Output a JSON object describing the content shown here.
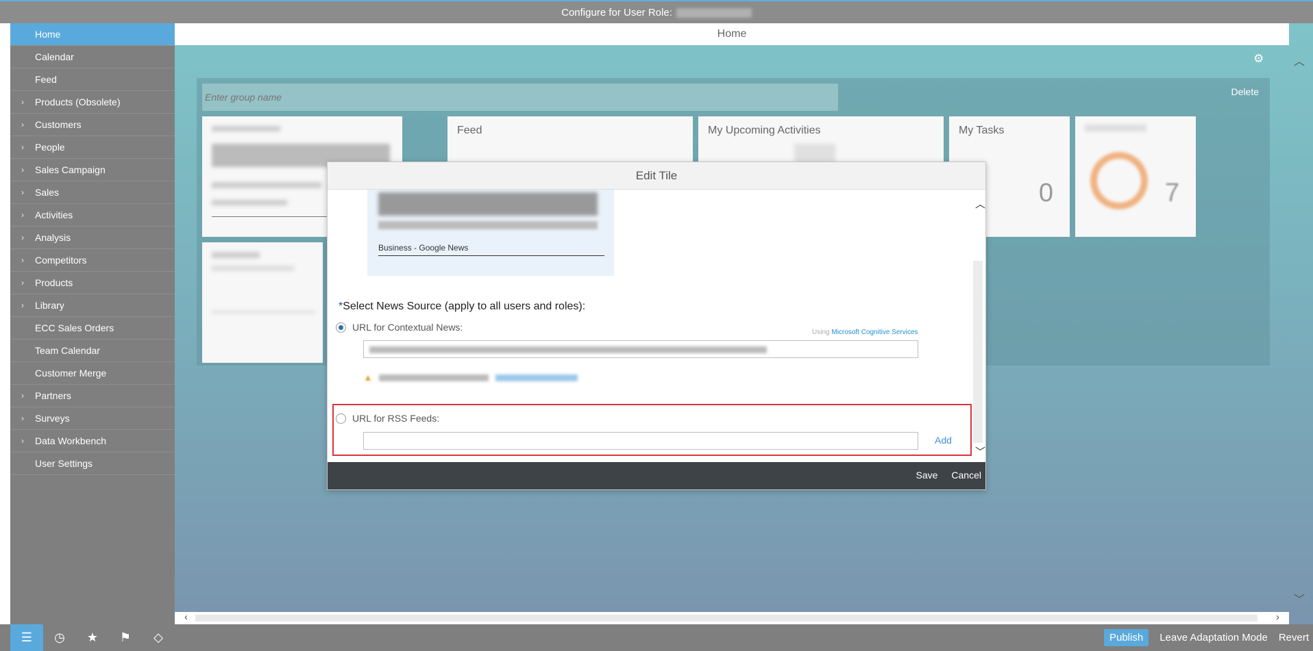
{
  "topbar": {
    "title": "Configure for User Role:"
  },
  "sidebar": {
    "items": [
      {
        "label": "Home",
        "expandable": false,
        "active": true
      },
      {
        "label": "Calendar",
        "expandable": false
      },
      {
        "label": "Feed",
        "expandable": false
      },
      {
        "label": "Products (Obsolete)",
        "expandable": true
      },
      {
        "label": "Customers",
        "expandable": true
      },
      {
        "label": "People",
        "expandable": true
      },
      {
        "label": "Sales Campaign",
        "expandable": true
      },
      {
        "label": "Sales",
        "expandable": true
      },
      {
        "label": "Activities",
        "expandable": true
      },
      {
        "label": "Analysis",
        "expandable": true
      },
      {
        "label": "Competitors",
        "expandable": true
      },
      {
        "label": "Products",
        "expandable": true
      },
      {
        "label": "Library",
        "expandable": true
      },
      {
        "label": "ECC Sales Orders",
        "expandable": false
      },
      {
        "label": "Team Calendar",
        "expandable": false
      },
      {
        "label": "Customer Merge",
        "expandable": false
      },
      {
        "label": "Partners",
        "expandable": true
      },
      {
        "label": "Surveys",
        "expandable": true
      },
      {
        "label": "Data Workbench",
        "expandable": true
      },
      {
        "label": "User Settings",
        "expandable": false
      }
    ]
  },
  "main": {
    "header": "Home",
    "group_placeholder": "Enter group name",
    "delete_label": "Delete",
    "tiles": {
      "feed": "Feed",
      "activities": "My Upcoming Activities",
      "tasks": "My Tasks",
      "tasks_count": "0",
      "closing_value": "7"
    }
  },
  "dialog": {
    "title": "Edit Tile",
    "preview_source": "Business - Google News",
    "section_title": "Select News Source (apply to all users and roles):",
    "required_mark": "*",
    "option_contextual": "URL for Contextual News:",
    "using_prefix": "Using",
    "using_link": "Microsoft Cognitive Services",
    "option_rss": "URL for RSS Feeds:",
    "add_label": "Add",
    "save_label": "Save",
    "cancel_label": "Cancel"
  },
  "bottombar": {
    "publish_label": "Publish",
    "leave_label": "Leave Adaptation Mode",
    "revert_label": "Revert"
  },
  "colors": {
    "accent": "#5aa9dc",
    "highlight_border": "#e0323a",
    "footer": "#3e4347"
  }
}
